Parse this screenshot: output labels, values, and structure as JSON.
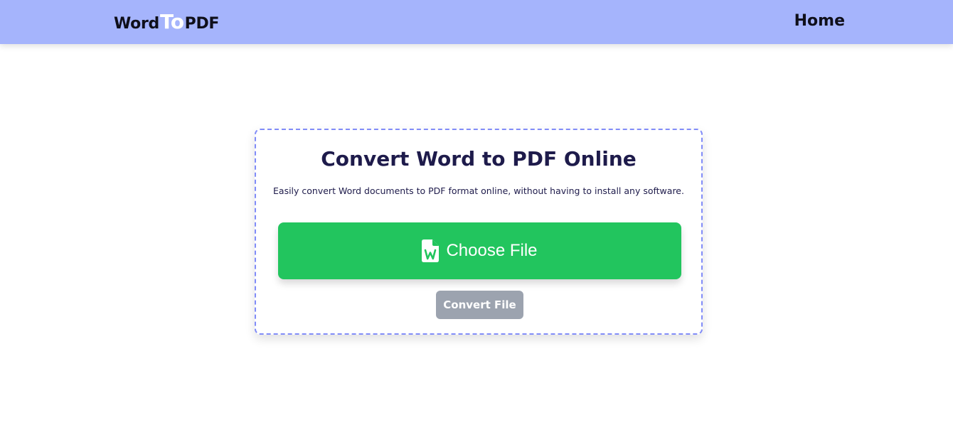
{
  "header": {
    "logo": {
      "part1": "Word",
      "part2": "To",
      "part3": "PDF"
    },
    "nav": {
      "home_label": "Home"
    }
  },
  "main": {
    "title": "Convert Word to PDF Online",
    "description": "Easily convert Word documents to PDF format online, without having to install any software.",
    "choose_button": {
      "label": "Choose File",
      "icon": "word-file-icon"
    },
    "convert_button": {
      "label": "Convert File",
      "state": "disabled"
    }
  },
  "colors": {
    "header_bg": "#a5b4fc",
    "card_border": "#818cf8",
    "choose_bg": "#22c55e",
    "convert_bg": "#9ca3af",
    "title": "#1e1b4b"
  }
}
